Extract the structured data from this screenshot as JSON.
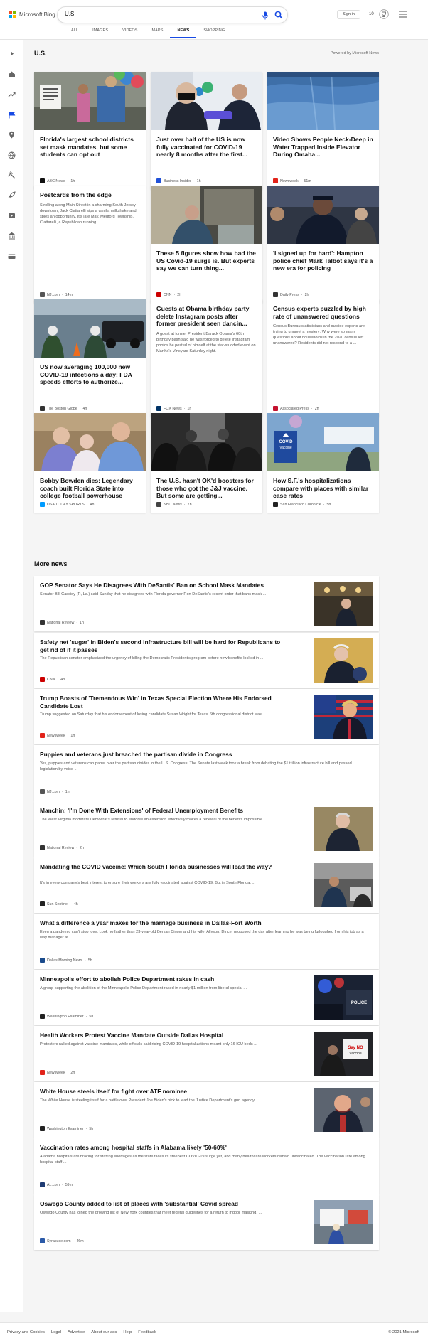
{
  "header": {
    "brand": "Microsoft Bing",
    "search_value": "U.S.",
    "sign_in": "Sign in",
    "rewards_points": "10",
    "nav": [
      "ALL",
      "IMAGES",
      "VIDEOS",
      "MAPS",
      "NEWS",
      "SHOPPING"
    ],
    "active_nav": "NEWS"
  },
  "section": {
    "title": "U.S.",
    "powered_by": "Powered by Microsoft News"
  },
  "cards": [
    {
      "title": "Florida's largest school districts set mask mandates, but some students can opt out",
      "source": "ABC News",
      "age": "1h",
      "img": "school"
    },
    {
      "title": "Just over half of the US is now fully vaccinated for COVID-19 nearly 8 months after the first...",
      "source": "Business Insider",
      "age": "1h",
      "img": "vaccine"
    },
    {
      "title": "Video Shows People Neck-Deep in Water Trapped Inside Elevator During Omaha...",
      "source": "Newsweek",
      "age": "51m",
      "img": "water"
    },
    {
      "title": "Postcards from the edge",
      "snippet": "Strolling along Main Street in a charming South Jersey downtown, Jack Ciattarelli sips a vanilla milkshake and spies an opportunity. It's late May. Medford Township. Ciattarelli, a Republican running ...",
      "source": "NJ.com",
      "age": "14m",
      "img": ""
    },
    {
      "title": "These 5 figures show how bad the US Covid-19 surge is. But experts say we can turn thing...",
      "source": "CNN",
      "age": "2h",
      "img": "hospital"
    },
    {
      "title": "'I signed up for hard': Hampton police chief Mark Talbot says it's a new era for policing",
      "source": "Daily Press",
      "age": "2h",
      "img": "police"
    },
    {
      "title": "US now averaging 100,000 new COVID-19 infections a day; FDA speeds efforts to authorize...",
      "source": "The Boston Globe",
      "age": "4h",
      "img": "testing"
    },
    {
      "title": "Guests at Obama birthday party delete Instagram posts after former president seen dancin...",
      "snippet": "A guest at former President Barack Obama's 60th birthday bash said he was forced to delete Instagram photos he posted of himself at the star-studded event on Martha's Vineyard Saturday night.",
      "source": "FOX News",
      "age": "1h",
      "img": ""
    },
    {
      "title": "Census experts puzzled by high rate of unanswered questions",
      "snippet": "Census Bureau statisticians and outside experts are trying to unravel a mystery: Why were so many questions about households in the 2020 census left unanswered? Residents did not respond to a ...",
      "source": "Associated Press",
      "age": "2h",
      "img": ""
    },
    {
      "title": "Bobby Bowden dies: Legendary coach built Florida State into college football powerhouse",
      "source": "USA TODAY SPORTS",
      "age": "4h",
      "img": "bowden"
    },
    {
      "title": "The U.S. hasn't OK'd boosters for those who got the J&J vaccine. But some are getting...",
      "source": "NBC News",
      "age": "7h",
      "img": "crowd"
    },
    {
      "title": "How S.F.'s hospitalizations compare with places with similar case rates",
      "source": "San Francisco Chronicle",
      "age": "5h",
      "img": "covidsign"
    }
  ],
  "more_news_title": "More news",
  "more_news": [
    {
      "title": "GOP Senator Says He Disagrees With DeSantis' Ban on School Mask Mandates",
      "snippet": "Senator Bill Cassidy (R, La.) said Sunday that he disagrees with Florida governor Ron DeSantis's recent order that bans mask ...",
      "source": "National Review",
      "age": "1h",
      "thumb": "senate"
    },
    {
      "title": "Safety net 'sugar' in Biden's second infrastructure bill will be hard for Republicans to get rid of if it passes",
      "snippet": "The Republican senator emphasized the urgency of killing the Democratic President's program before new benefits locked in ...",
      "source": "CNN",
      "age": "4h",
      "thumb": "biden"
    },
    {
      "title": "Trump Boasts of 'Tremendous Win' in Texas Special Election Where His Endorsed Candidate Lost",
      "snippet": "Trump suggested on Saturday that his endorsement of losing candidate Susan Wright for Texas' 6th congressional district was ...",
      "source": "Newsweek",
      "age": "1h",
      "thumb": "trump"
    },
    {
      "title": "Puppies and veterans just breached the partisan divide in Congress",
      "snippet": "Yes, puppies and veterans can paper over the partisan divides in the U.S. Congress. The Senate last week took a break from debating the $1 trillion infrastructure bill and passed legislation by voice ...",
      "source": "NJ.com",
      "age": "1h",
      "thumb": ""
    },
    {
      "title": "Manchin: 'I'm Done With Extensions' of Federal Unemployment Benefits",
      "snippet": "The West Virginia moderate Democrat's refusal to endorse an extension effectively makes a renewal of the benefits impossible.",
      "source": "National Review",
      "age": "2h",
      "thumb": "manchin"
    },
    {
      "title": "Mandating the COVID vaccine: Which South Florida businesses will lead the way?",
      "snippet": "It's in every company's best interest to ensure their workers are fully vaccinated against COVID-19. But in South Florida, ...",
      "source": "Sun Sentinel",
      "age": "4h",
      "thumb": "kitchen"
    },
    {
      "title": "What a difference a year makes for the marriage business in Dallas-Fort Worth",
      "snippet": "Even a pandemic can't stop love. Look no farther than 23-year-old Berkan Dincer and his wife, Allyson. Dincer proposed the day after learning he was being furloughed from his job as a way manager at ...",
      "source": "Dallas Morning News",
      "age": "5h",
      "thumb": ""
    },
    {
      "title": "Minneapolis effort to abolish Police Department rakes in cash",
      "snippet": "A group supporting the abolition of the Minneapolis Police Department raked in nearly $1 million from liberal special ...",
      "source": "Washington Examiner",
      "age": "5h",
      "thumb": "policecar"
    },
    {
      "title": "Health Workers Protest Vaccine Mandate Outside Dallas Hospital",
      "snippet": "Protesters rallied against vaccine mandates, while officials said rising COVID-19 hospitalizations meant only 16 ICU beds ...",
      "source": "Newsweek",
      "age": "2h",
      "thumb": "protest"
    },
    {
      "title": "White House steels itself for fight over ATF nominee",
      "snippet": "The White House is steeling itself for a battle over President Joe Biden's pick to lead the Justice Department's gun agency ...",
      "source": "Washington Examiner",
      "age": "5h",
      "thumb": "nominee"
    },
    {
      "title": "Vaccination rates among hospital staffs in Alabama likely '50-60%'",
      "snippet": "Alabama hospitals are bracing for staffing shortages as the state faces its steepest COVID-19 surge yet, and many healthcare workers remain unvaccinated. The vaccination rate among hospital staff ...",
      "source": "AL.com",
      "age": "59m",
      "thumb": ""
    },
    {
      "title": "Oswego County added to list of places with 'substantial' Covid spread",
      "snippet": "Oswego County has joined the growing list of New York counties that meet federal guidelines for a return to indoor masking. ...",
      "source": "Syracuse.com",
      "age": "46m",
      "thumb": "testsite"
    }
  ],
  "footer": {
    "links": [
      "Privacy and Cookies",
      "Legal",
      "Advertise",
      "About our ads",
      "Help",
      "Feedback"
    ],
    "copyright": "© 2021 Microsoft"
  },
  "source_colors": {
    "ABC News": "#111111",
    "Business Insider": "#2151d8",
    "Newsweek": "#e2231a",
    "NJ.com": "#555555",
    "CNN": "#cc0000",
    "Daily Press": "#333333",
    "The Boston Globe": "#333333",
    "FOX News": "#003366",
    "Associated Press": "#c4122f",
    "USA TODAY SPORTS": "#009bff",
    "NBC News": "#444444",
    "San Francisco Chronicle": "#222222",
    "National Review": "#333333",
    "Sun Sentinel": "#222222",
    "Dallas Morning News": "#1a4b8c",
    "Washington Examiner": "#222222",
    "AL.com": "#1f3b73",
    "Syracuse.com": "#2b5aa8"
  }
}
